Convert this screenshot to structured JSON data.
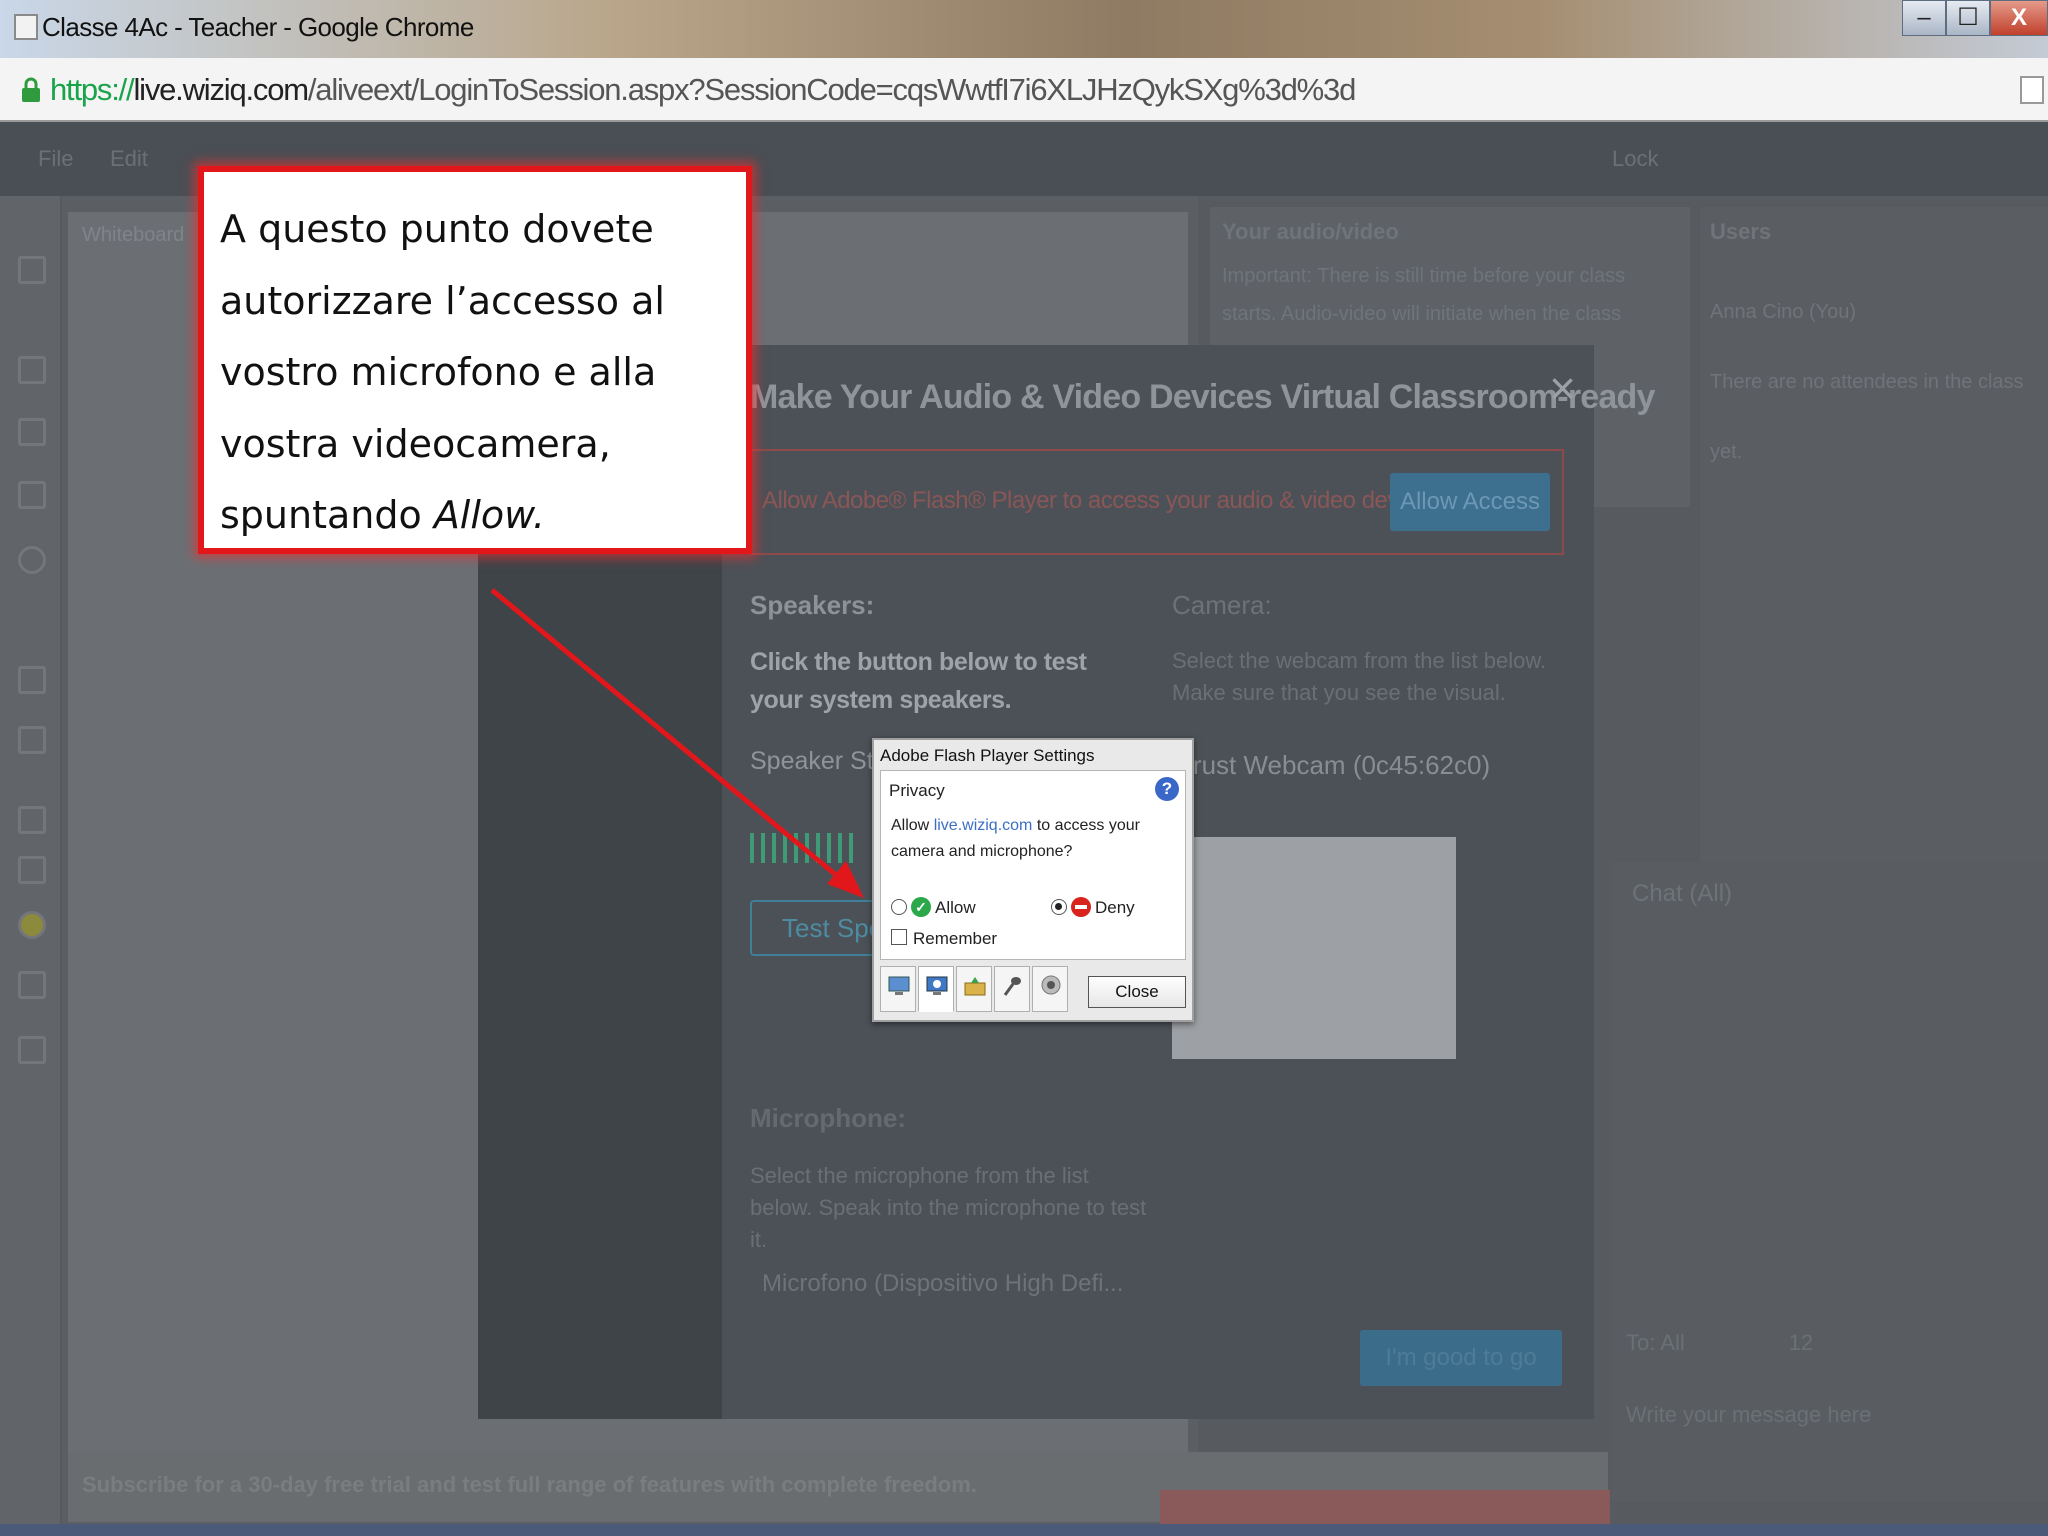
{
  "window": {
    "title": "Classe 4Ac - Teacher - Google Chrome",
    "buttons": {
      "minimize": "–",
      "maximize": "☐",
      "close": "X"
    }
  },
  "address": {
    "scheme": "https://",
    "host": "live.wiziq.com",
    "path": "/aliveext/LoginToSession.aspx?SessionCode=cqsWwtfI7i6XLJHzQykSXg%3d%3d"
  },
  "app": {
    "menu": [
      "File",
      "Edit",
      "Lock"
    ],
    "whiteboard_label": "Whiteboard",
    "av_panel": {
      "title": "Your audio/video",
      "text": "Important: There is still time before your class starts. Audio-video will initiate when the class starts.",
      "close": "×"
    },
    "people_panel": {
      "title": "Users",
      "line1": "Anna Cino (You)",
      "line2": "There are no attendees in the class yet."
    },
    "chat": {
      "title": "Chat (All)",
      "to_label": "To:",
      "to_value": "All",
      "font_size": "12",
      "placeholder": "Write your message here"
    },
    "trial_text": "Subscribe for a 30-day free trial and test full range of features with complete freedom."
  },
  "modal": {
    "title": "Make Your Audio & Video Devices Virtual Classroom-ready",
    "close": "×",
    "allow_text": "Allow Adobe® Flash® Player to access your audio & video devices.",
    "allow_button": "Allow Access",
    "speakers_heading": "Speakers:",
    "speakers_text": "Click the button below to test your system speakers.",
    "speaker_status": "Speaker Status",
    "test_button": "Test Speakers",
    "camera_heading": "Camera:",
    "camera_text": "Select the webcam from the list below. Make sure that you see the visual.",
    "camera_select": "Trust Webcam (0c45:62c0)",
    "mic_heading": "Microphone:",
    "mic_text": "Select the microphone from the list below. Speak into the microphone to test it.",
    "mic_select": "Microfono (Dispositivo High Defi...",
    "good_button": "I'm good to go"
  },
  "flash": {
    "title": "Adobe Flash Player Settings",
    "section": "Privacy",
    "help": "?",
    "question_pre": "Allow ",
    "question_link": "live.wiziq.com",
    "question_post": " to access your camera and microphone?",
    "allow_label": "Allow",
    "deny_label": "Deny",
    "selected": "Deny",
    "remember_label": "Remember",
    "remember_checked": false,
    "close_button": "Close",
    "tabs": [
      "display-icon",
      "privacy-icon",
      "storage-icon",
      "microphone-icon",
      "camera-icon"
    ]
  },
  "annotation": {
    "line1": "A questo punto dovete",
    "line2": "autorizzare l’accesso al",
    "line3": "vostro microfono e alla",
    "line4": "vostra videocamera,",
    "line5_pre": "spuntando ",
    "line5_em": "Allow.",
    "colors": {
      "border": "#e2171c",
      "arrow": "#e2171c"
    }
  }
}
